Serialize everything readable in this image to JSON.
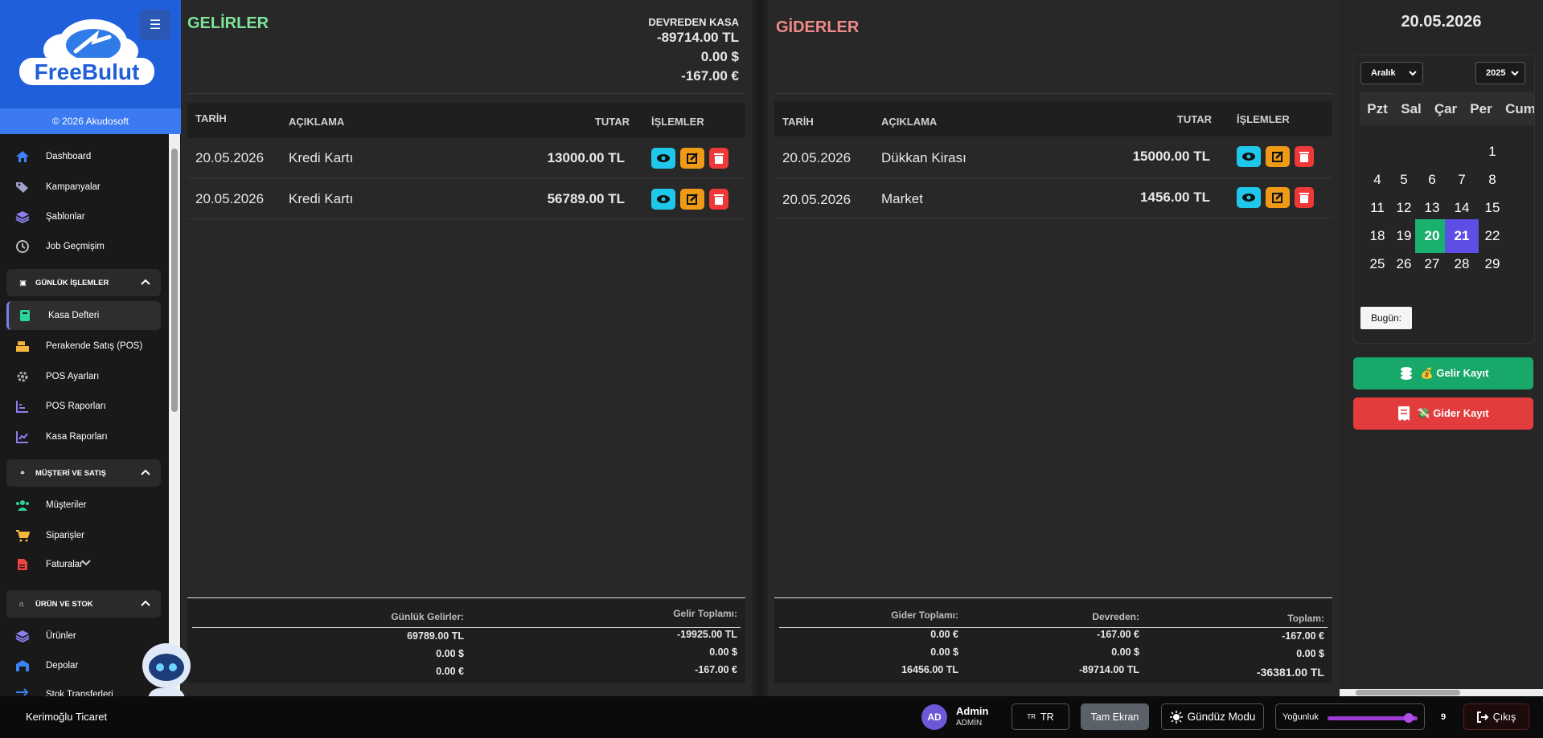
{
  "sidebar": {
    "brand": "FreeBulut",
    "copyright": "© 2026 Akudosoft",
    "items": [
      {
        "label": "Dashboard"
      },
      {
        "label": "Kampanyalar"
      },
      {
        "label": "Şablonlar"
      },
      {
        "label": "Job Geçmişim"
      }
    ],
    "sections": [
      {
        "label": "GÜNLÜK İŞLEMLER",
        "items": [
          "Kasa Defteri",
          "Perakende Satış (POS)",
          "POS Ayarları",
          "POS Raporları",
          "Kasa Raporları"
        ]
      },
      {
        "label": "MÜŞTERİ VE SATIŞ",
        "items": [
          "Müşteriler",
          "Siparişler",
          "Faturalar"
        ]
      },
      {
        "label": "ÜRÜN VE STOK",
        "items": [
          "Ürünler",
          "Depolar",
          "Stok Transferleri"
        ]
      }
    ],
    "active_item": "Kasa Defteri"
  },
  "income": {
    "title": "GELİRLER",
    "carry_label": "DEVREDEN KASA",
    "carry_values": [
      "-89714.00 TL",
      "0.00 $",
      "-167.00 €"
    ],
    "columns": {
      "date": "TARİH",
      "desc": "AÇIKLAMA",
      "amount": "TUTAR",
      "actions": "İŞLEMLER"
    },
    "rows": [
      {
        "date": "20.05.2026",
        "desc": "Kredi Kartı",
        "amount": "13000.00 TL"
      },
      {
        "date": "20.05.2026",
        "desc": "Kredi Kartı",
        "amount": "56789.00 TL"
      }
    ],
    "footer": {
      "daily_label": "Günlük Gelirler:",
      "daily_values": [
        "69789.00 TL",
        "0.00 $",
        "0.00 €"
      ],
      "total_label": "Gelir Toplamı:",
      "total_values": [
        "-19925.00 TL",
        "0.00 $",
        "-167.00 €"
      ]
    }
  },
  "expense": {
    "title": "GİDERLER",
    "columns": {
      "date": "TARİH",
      "desc": "AÇIKLAMA",
      "amount": "TUTAR",
      "actions": "İŞLEMLER"
    },
    "rows": [
      {
        "date": "20.05.2026",
        "desc": "Dükkan Kirası",
        "amount": "15000.00 TL"
      },
      {
        "date": "20.05.2026",
        "desc": "Market",
        "amount": "1456.00 TL"
      }
    ],
    "footer": {
      "total_label": "Gider Toplamı:",
      "total_values": [
        "0.00 €",
        "0.00 $",
        "16456.00 TL"
      ],
      "carry_label": "Devreden:",
      "carry_values": [
        "-167.00 €",
        "0.00 $",
        "-89714.00 TL"
      ],
      "sum_label": "Toplam:",
      "sum_values": [
        "-167.00 €",
        "0.00 $",
        "-36381.00 TL"
      ]
    }
  },
  "calendar": {
    "current_date": "20.05.2026",
    "month_select": "Aralık",
    "year_select": "2025",
    "weekdays": [
      "Pzt",
      "Sal",
      "Çar",
      "Per",
      "Cum"
    ],
    "weeks": [
      [
        "",
        "",
        "",
        "",
        "1"
      ],
      [
        "4",
        "5",
        "6",
        "7",
        "8"
      ],
      [
        "11",
        "12",
        "13",
        "14",
        "15"
      ],
      [
        "18",
        "19",
        "20",
        "21",
        "22"
      ],
      [
        "25",
        "26",
        "27",
        "28",
        "29"
      ]
    ],
    "selected_day": "20",
    "today_day": "21",
    "today_button": "Bugün:"
  },
  "actions": {
    "income_button": "💰 Gelir Kayıt",
    "expense_button": "💸 Gider Kayıt"
  },
  "bottombar": {
    "company": "Kerimoğlu Ticaret",
    "avatar_initials": "AD",
    "user_name": "Admin",
    "user_role": "ADMİN",
    "language_flag": "TR",
    "language": "TR",
    "fullscreen": "Tam Ekran",
    "day_mode": "Gündüz Modu",
    "density_label": "Yoğunluk",
    "density_value": "9",
    "density_level": 0.9,
    "logout": "Çıkış"
  },
  "colors": {
    "income_title": "#7fe39a",
    "expense_title": "#f08a8a",
    "brand_blue": "#1f5fd9",
    "selected_day": "#1ab06e",
    "today": "#5d4ee6"
  }
}
